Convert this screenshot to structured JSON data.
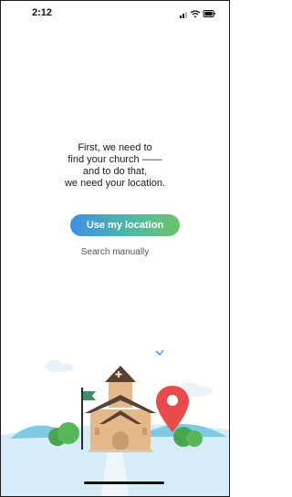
{
  "status_bar": {
    "time": "2:12",
    "icons": [
      "signal-icon",
      "wifi-icon",
      "battery-icon"
    ]
  },
  "prompt": {
    "lines": [
      "First, we need to",
      "find your church ——",
      "and to do that,",
      "we need your location."
    ]
  },
  "actions": {
    "use_location_label": "Use my location",
    "search_manually_label": "Search manually"
  },
  "colors": {
    "button_gradient_start": "#3f8fe6",
    "button_gradient_end": "#6cc567",
    "pin": "#e74b4b",
    "flag": "#3f8f6a",
    "church_roof": "#5b3f33",
    "church_wall": "#e5b889"
  },
  "illustration": {
    "icon": "church-with-location-pin-illustration"
  }
}
